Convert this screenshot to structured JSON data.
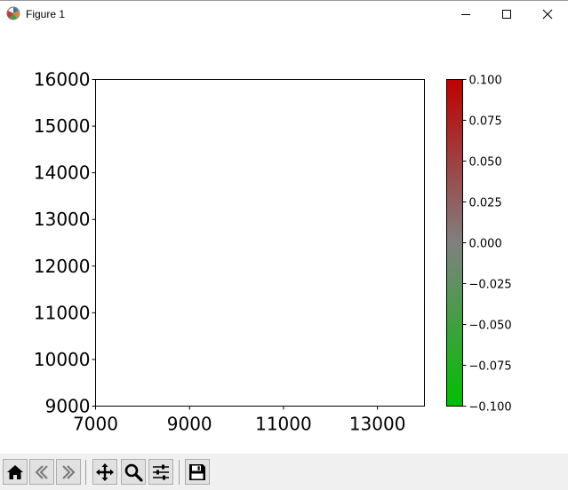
{
  "window": {
    "title": "Figure 1",
    "icons": {
      "app": "matplotlib-icon",
      "minimize": "minimize-icon",
      "maximize": "maximize-icon",
      "close": "close-icon"
    }
  },
  "toolbar": {
    "buttons": [
      {
        "name": "home-button",
        "icon": "home-icon"
      },
      {
        "name": "back-button",
        "icon": "back-arrow-icon"
      },
      {
        "name": "forward-button",
        "icon": "forward-arrow-icon"
      },
      {
        "name": "pan-button",
        "icon": "move-icon"
      },
      {
        "name": "zoom-button",
        "icon": "magnifier-icon"
      },
      {
        "name": "subplots-button",
        "icon": "sliders-icon"
      },
      {
        "name": "save-button",
        "icon": "floppy-disk-icon"
      }
    ]
  },
  "chart_data": {
    "type": "heatmap",
    "title": "",
    "xlabel": "",
    "ylabel": "",
    "xlim": [
      7000,
      14000
    ],
    "ylim": [
      9000,
      16000
    ],
    "x_ticks": [
      "7000",
      "9000",
      "11000",
      "13000"
    ],
    "x_tick_values": [
      7000,
      9000,
      11000,
      13000
    ],
    "y_ticks": [
      "9000",
      "10000",
      "11000",
      "12000",
      "13000",
      "14000",
      "15000",
      "16000"
    ],
    "y_tick_values": [
      9000,
      10000,
      11000,
      12000,
      13000,
      14000,
      15000,
      16000
    ],
    "values": [],
    "grid": false,
    "colorbar": {
      "range": [
        -0.1,
        0.1
      ],
      "ticks": [
        "−0.100",
        "−0.075",
        "−0.050",
        "−0.025",
        "0.000",
        "0.025",
        "0.050",
        "0.075",
        "0.100"
      ],
      "tick_values": [
        -0.1,
        -0.075,
        -0.05,
        -0.025,
        0,
        0.025,
        0.05,
        0.075,
        0.1
      ],
      "colors": {
        "low": "#00c000",
        "mid": "#808080",
        "high": "#c00000"
      }
    }
  }
}
